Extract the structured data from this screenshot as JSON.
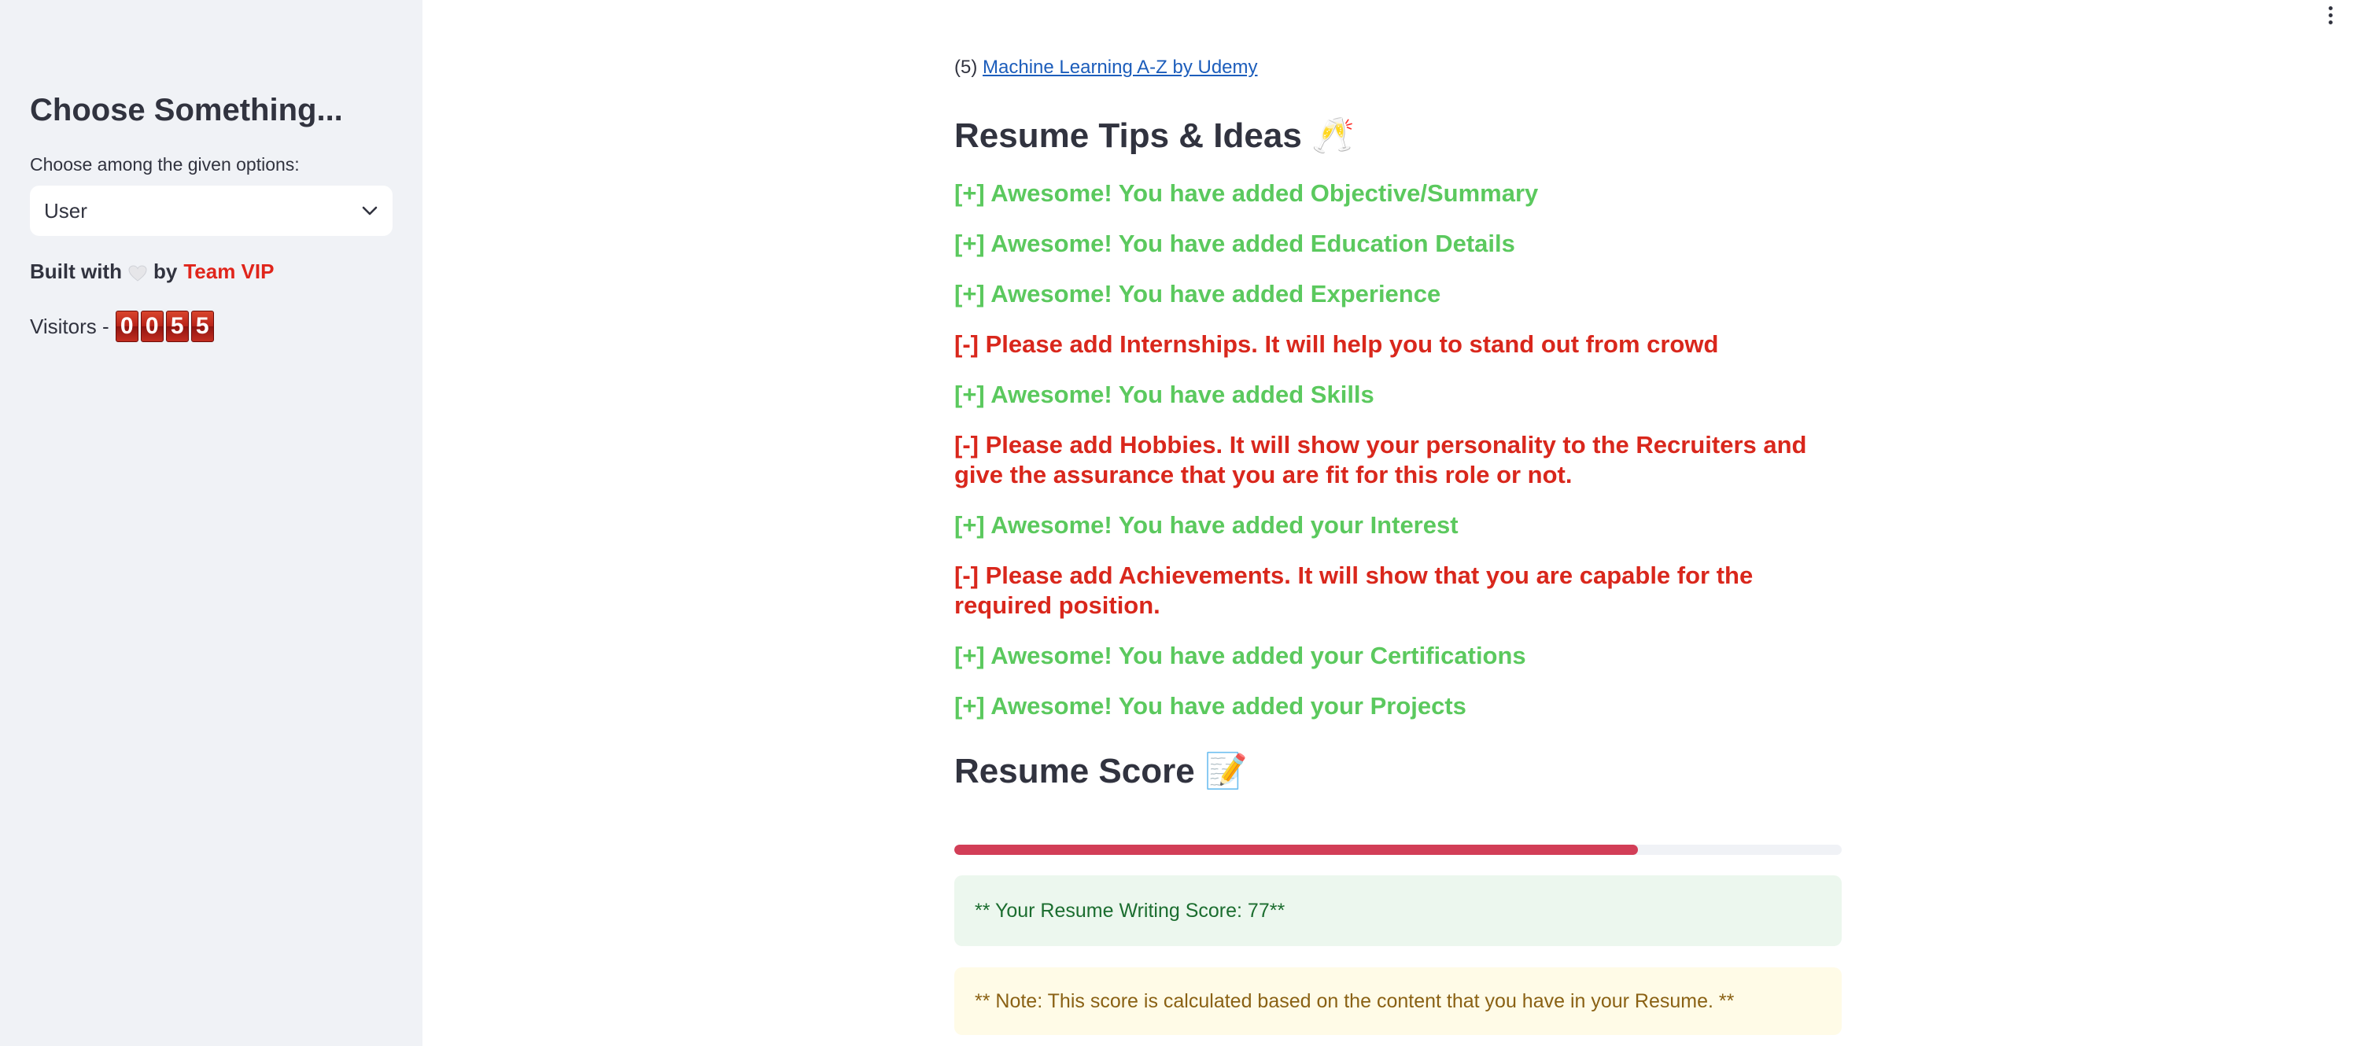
{
  "sidebar": {
    "title": "Choose Something...",
    "select_label": "Choose among the given options:",
    "select_value": "User",
    "built_prefix": "Built with",
    "built_by": "by",
    "team_name": "Team VIP",
    "visitors_label": "Visitors -",
    "visitor_digits": [
      "0",
      "0",
      "5",
      "5"
    ]
  },
  "main": {
    "course_number": "(5)",
    "course_link": "Machine Learning A-Z by Udemy",
    "tips_title": "Resume Tips & Ideas",
    "tips_emoji": "🥂",
    "tips": [
      "[+] Awesome! You have added Objective/Summary",
      "[+] Awesome! You have added Education Details",
      "[+] Awesome! You have added Experience",
      "[-] Please add Internships. It will help you to stand out from crowd",
      "[+] Awesome! You have added Skills",
      "[-] Please add Hobbies. It will show your personality to the Recruiters and give the assurance that you are fit for this role or not.",
      "[+] Awesome! You have added your Interest",
      "[-] Please add Achievements. It will show that you are capable for the required position.",
      "[+] Awesome! You have added your Certifications",
      "[+] Awesome! You have added your Projects"
    ],
    "score_title": "Resume Score",
    "score_emoji": "📝",
    "score_progress_percent": 77,
    "score_text": "** Your Resume Writing Score: 77**",
    "note_text": "** Note: This score is calculated based on the content that you have in your Resume. **"
  },
  "colors": {
    "positive": "#5bc95e",
    "negative": "#d9271c",
    "progress": "#d23e57",
    "link": "#1c5dbb",
    "team": "#e0251b"
  }
}
